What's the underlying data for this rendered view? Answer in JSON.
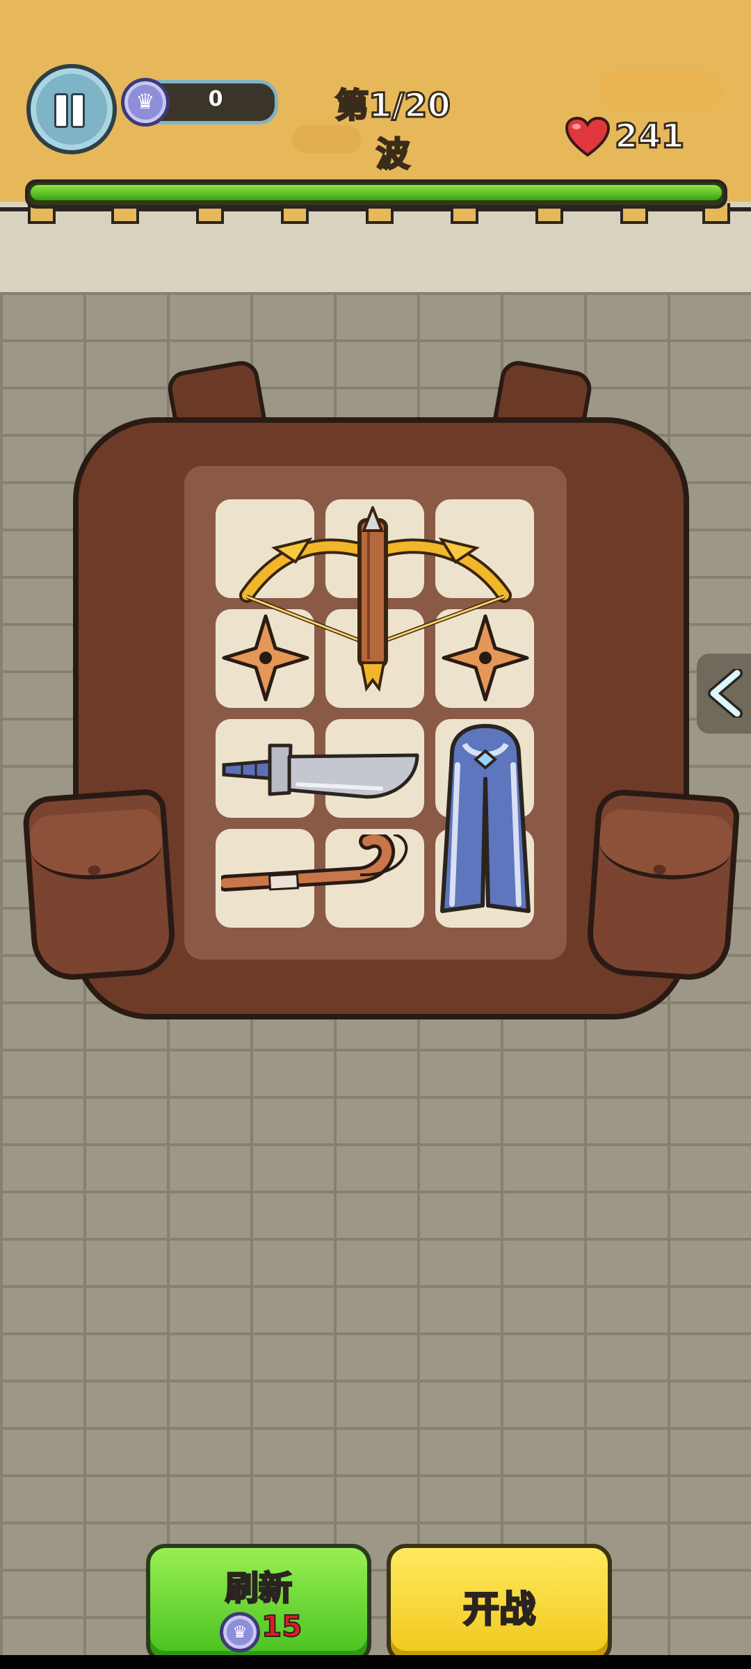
{
  "hud": {
    "coins": "0",
    "wave_title": "第1/20波",
    "health": "241",
    "wave_progress_fraction": 1.0
  },
  "backpack": {
    "items": [
      {
        "name": "crossbow"
      },
      {
        "name": "shuriken"
      },
      {
        "name": "shuriken"
      },
      {
        "name": "dagger"
      },
      {
        "name": "cloak"
      },
      {
        "name": "shepherd-staff"
      }
    ]
  },
  "buttons": {
    "refresh_label": "刷新",
    "refresh_cost": "15",
    "start_label": "开战"
  },
  "colors": {
    "progress_green": "#4fc41a",
    "refresh_green": "#5fd42c",
    "start_yellow": "#ffe03a",
    "sand": "#e6b85a"
  }
}
